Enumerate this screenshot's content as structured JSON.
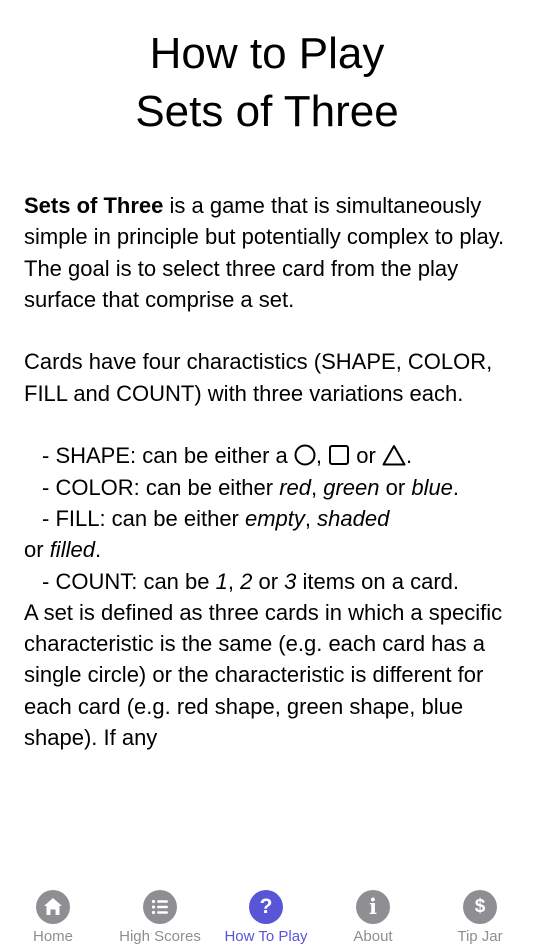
{
  "header": {
    "title_line1": "How to Play",
    "title_line2": "Sets of Three"
  },
  "intro": {
    "bold_name": "Sets of Three",
    "text": " is a game that is simultaneously simple in principle but potentially complex to play.  The goal is to select three card from the play surface that comprise a set."
  },
  "cards_intro": "Cards have four charactistics (SHAPE, COLOR, FILL and COUNT) with three variations each.",
  "characteristics": {
    "shape": {
      "prefix": "- SHAPE: can be either a ",
      "sep1": ", ",
      "sep2": " or ",
      "end": "."
    },
    "color": {
      "prefix": "- COLOR: can be either ",
      "v1": "red",
      "sep1": ", ",
      "v2": "green",
      "sep2": " or ",
      "v3": "blue",
      "end": "."
    },
    "fill": {
      "prefix": "- FILL: can be either ",
      "v1": "empty",
      "sep1": ", ",
      "v2": "shaded",
      "wrap_or": "or ",
      "v3": "filled",
      "end": "."
    },
    "count": {
      "prefix": "- COUNT: can be ",
      "v1": "1",
      "sep1": ", ",
      "v2": "2",
      "sep2": " or ",
      "v3": "3",
      "end": " items on a card."
    }
  },
  "set_definition": "A set is defined as three cards in which a specific characteristic is the same (e.g. each card has a single circle) or the characteristic is different for each card (e.g. red shape, green shape, blue shape). If any",
  "tabbar": {
    "active_color": "#5856d6",
    "inactive_color": "#8e8e93",
    "tabs": [
      {
        "label": "Home",
        "icon": "house-icon"
      },
      {
        "label": "High Scores",
        "icon": "list-icon"
      },
      {
        "label": "How To Play",
        "icon": "question-icon"
      },
      {
        "label": "About",
        "icon": "info-icon"
      },
      {
        "label": "Tip Jar",
        "icon": "dollar-icon"
      }
    ]
  }
}
